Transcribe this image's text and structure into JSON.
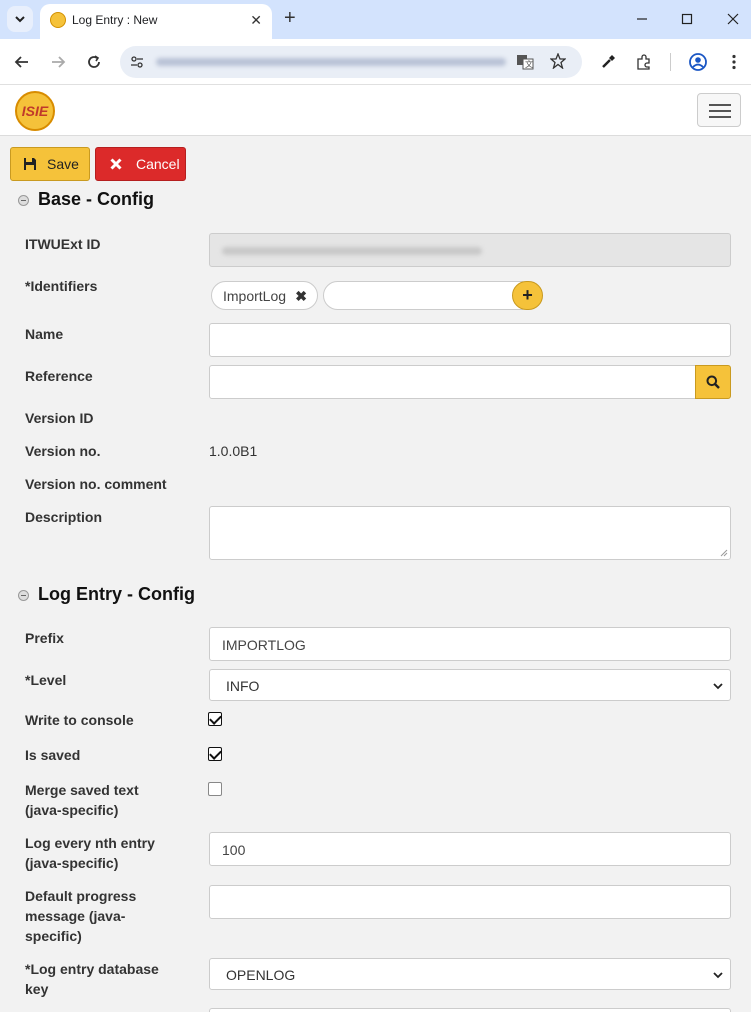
{
  "browser": {
    "tab_title": "Log Entry : New",
    "tab_close": "✕",
    "new_tab": "+"
  },
  "toolbar": {
    "save_label": "Save",
    "cancel_label": "Cancel"
  },
  "app": {
    "logo_text": "ISIE"
  },
  "sections": {
    "base_title": "Base - Config",
    "log_title": "Log Entry - Config"
  },
  "base": {
    "itwuext_label": "ITWUExt ID",
    "identifiers_label": "*Identifiers",
    "identifier_chip": "ImportLog",
    "chip_remove": "✖",
    "add_symbol": "+",
    "name_label": "Name",
    "reference_label": "Reference",
    "version_id_label": "Version ID",
    "version_no_label": "Version no.",
    "version_no_value": "1.0.0B1",
    "version_comment_label": "Version no. comment",
    "description_label": "Description"
  },
  "log": {
    "prefix_label": "Prefix",
    "prefix_value": "IMPORTLOG",
    "level_label": "*Level",
    "level_value": "INFO",
    "write_console_label": "Write to console",
    "write_console_checked": true,
    "is_saved_label": "Is saved",
    "is_saved_checked": true,
    "merge_label": "Merge saved text (java-specific)",
    "merge_checked": false,
    "nth_label": "Log every nth entry (java-specific)",
    "nth_value": "100",
    "progress_label": "Default progress message (java-specific)",
    "db_key_label": "*Log entry database key",
    "db_key_value": "OPENLOG"
  }
}
